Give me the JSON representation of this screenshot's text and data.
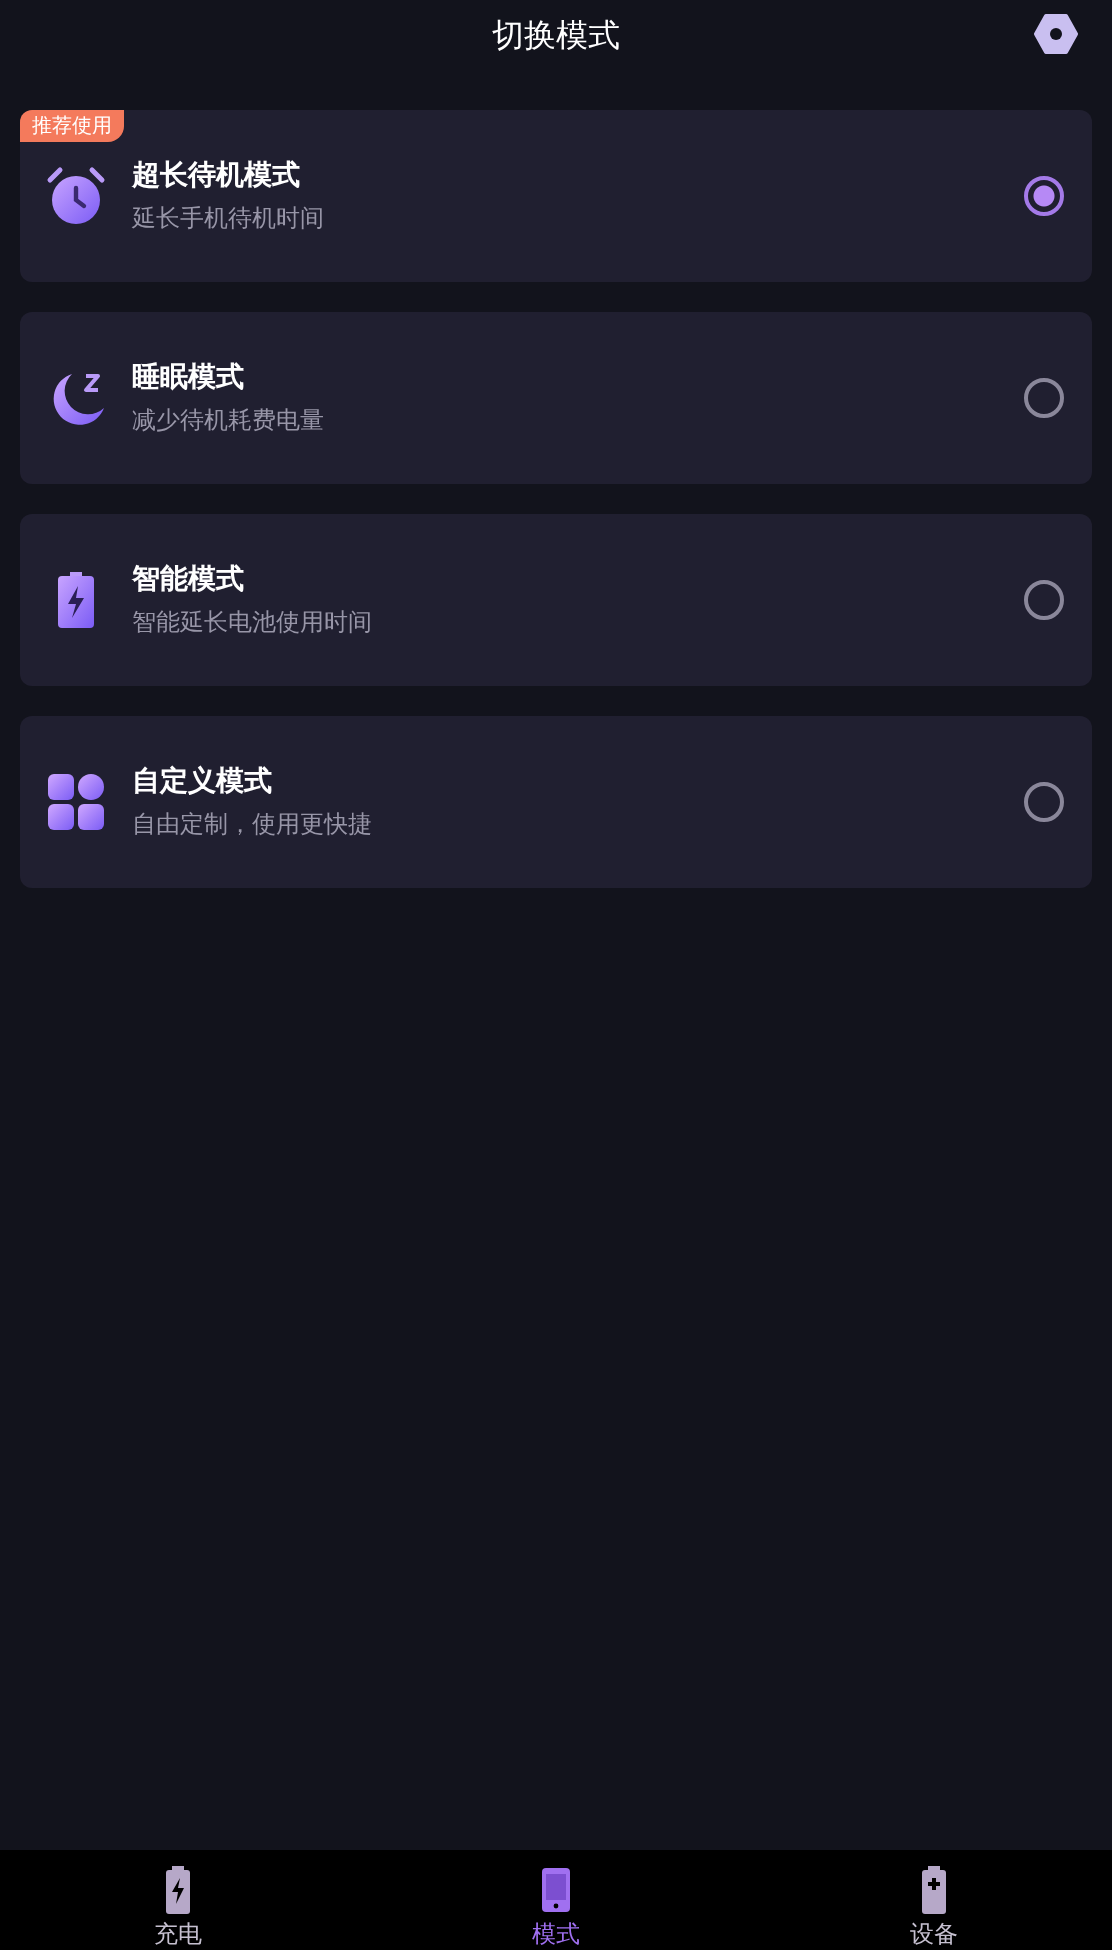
{
  "header": {
    "title": "切换模式"
  },
  "modes": [
    {
      "kind": "alarm",
      "title": "超长待机模式",
      "subtitle": "延长手机待机时间",
      "badge": "推荐使用",
      "selected": true
    },
    {
      "kind": "moon",
      "title": "睡眠模式",
      "subtitle": "减少待机耗费电量",
      "selected": false
    },
    {
      "kind": "battery",
      "title": "智能模式",
      "subtitle": "智能延长电池使用时间",
      "selected": false
    },
    {
      "kind": "grid",
      "title": "自定义模式",
      "subtitle": "自由定制，使用更快捷",
      "selected": false
    }
  ],
  "nav": [
    {
      "kind": "charge",
      "label": "充电",
      "selected": false
    },
    {
      "kind": "phone",
      "label": "模式",
      "selected": true
    },
    {
      "kind": "device",
      "label": "设备",
      "selected": false
    }
  ]
}
